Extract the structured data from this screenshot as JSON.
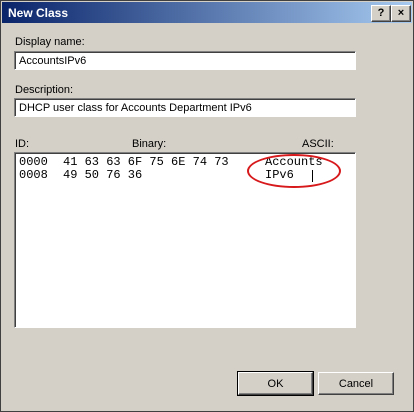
{
  "window": {
    "title": "New Class",
    "help_glyph": "?",
    "close_glyph": "×"
  },
  "display_name": {
    "label": "Display name:",
    "value": "AccountsIPv6"
  },
  "description": {
    "label": "Description:",
    "value": "DHCP user class for Accounts Department IPv6"
  },
  "data_editor": {
    "col_id": "ID:",
    "col_binary": "Binary:",
    "col_ascii": "ASCII:",
    "rows": [
      {
        "id": "0000",
        "bytes": "41 63 63 6F 75 6E 74 73",
        "ascii": "Accounts"
      },
      {
        "id": "0008",
        "bytes": "49 50 76 36",
        "ascii": "IPv6"
      }
    ]
  },
  "buttons": {
    "ok": "OK",
    "cancel": "Cancel"
  },
  "colors": {
    "titlebar_start": "#0a246a",
    "titlebar_end": "#a6caf0",
    "highlight": "#d7191c"
  }
}
